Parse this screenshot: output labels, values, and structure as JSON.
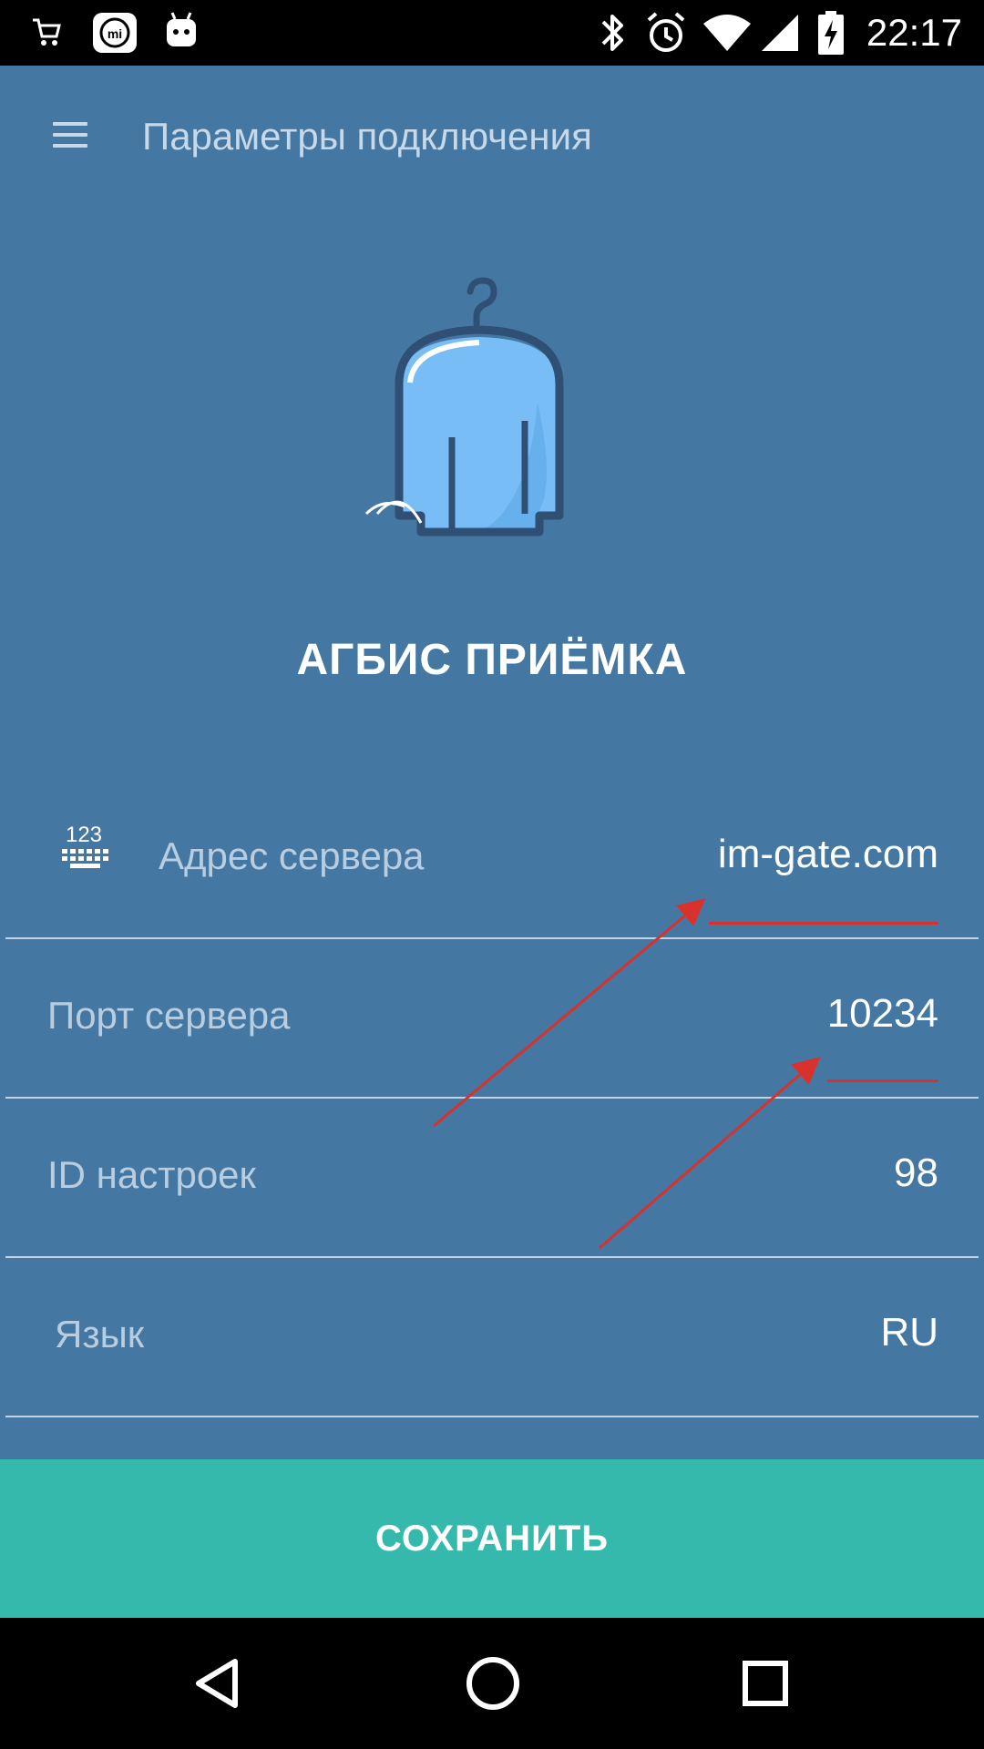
{
  "status_bar": {
    "time": "22:17",
    "left_icons": [
      "shopping-cart-notification-icon",
      "mi-app-icon",
      "android-debug-icon"
    ],
    "right_icons": [
      "bluetooth-icon",
      "alarm-icon",
      "wifi-icon",
      "cellular-signal-icon",
      "battery-charging-icon"
    ]
  },
  "toolbar": {
    "menu_icon": "hamburger-menu-icon",
    "title": "Параметры подключения"
  },
  "brand": {
    "logo_icon": "hanger-garment-logo",
    "name": "АГБИС ПРИЁМКА"
  },
  "settings": [
    {
      "label": "Адрес сервера",
      "value": "im-gate.com",
      "icon": "keyboard-123-icon"
    },
    {
      "label": "Порт сервера",
      "value": "10234"
    },
    {
      "label": "ID настроек",
      "value": "98"
    },
    {
      "label": "Язык",
      "value": "RU"
    }
  ],
  "save_button": {
    "label": "СОХРАНИТЬ"
  },
  "nav_bar": {
    "icons": [
      "back-triangle-icon",
      "home-circle-icon",
      "recents-square-icon"
    ]
  },
  "colors": {
    "app_background": "#4478a2",
    "save_button": "#35b9ad",
    "annotation_red": "#d9322c",
    "divider": "#c2d4e4"
  }
}
